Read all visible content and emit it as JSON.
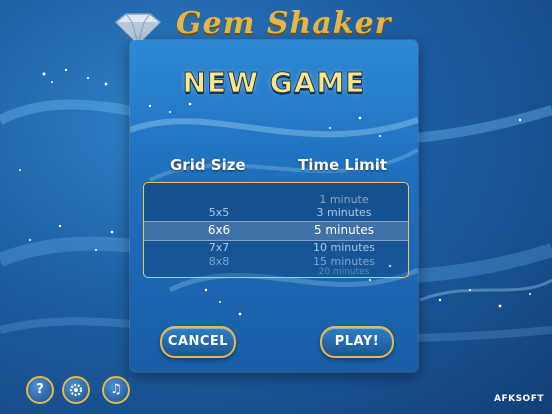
{
  "header": {
    "logo_text": "Gem Shaker"
  },
  "dialog": {
    "title": "NEW GAME",
    "grid_size_label": "Grid Size",
    "time_limit_label": "Time Limit",
    "grid_options": [
      "5x5",
      "6x6",
      "7x7",
      "8x8"
    ],
    "grid_selected": "6x6",
    "time_options": [
      "1 minute",
      "3 minutes",
      "5 minutes",
      "10 minutes",
      "15 minutes",
      "20 minutes"
    ],
    "time_selected": "5 minutes",
    "cancel_label": "CANCEL",
    "play_label": "PLAY!"
  },
  "toolbar": {
    "help_icon": "help-icon",
    "settings_icon": "gear-icon",
    "music_icon": "music-icon"
  },
  "footer": {
    "brand": "AFKSOFT"
  },
  "colors": {
    "background": "#1d5fa3",
    "panel": "#1f6fbd",
    "gold_accent": "#e6b94b",
    "title_text": "#ffe680"
  }
}
